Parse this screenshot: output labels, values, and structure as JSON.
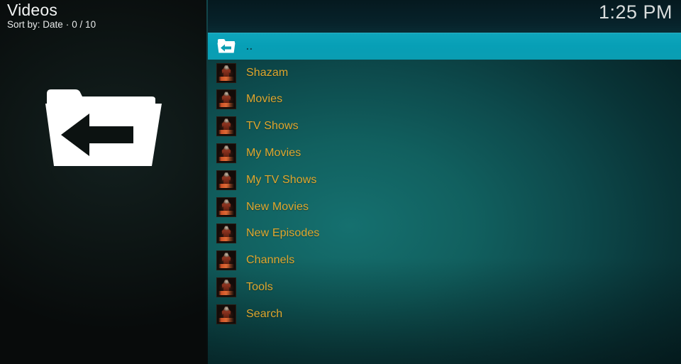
{
  "header": {
    "title": "Videos",
    "sort_label": "Sort by: Date",
    "separator": "·",
    "count": "0 / 10",
    "clock": "1:25 PM"
  },
  "left_panel": {
    "icon": "folder-back-icon"
  },
  "list": {
    "items": [
      {
        "label": "..",
        "icon": "folder-back-icon",
        "selected": true
      },
      {
        "label": "Shazam",
        "icon": "addon-thumbnail-icon",
        "selected": false
      },
      {
        "label": "Movies",
        "icon": "addon-thumbnail-icon",
        "selected": false
      },
      {
        "label": "TV Shows",
        "icon": "addon-thumbnail-icon",
        "selected": false
      },
      {
        "label": "My Movies",
        "icon": "addon-thumbnail-icon",
        "selected": false
      },
      {
        "label": "My TV Shows",
        "icon": "addon-thumbnail-icon",
        "selected": false
      },
      {
        "label": "New Movies",
        "icon": "addon-thumbnail-icon",
        "selected": false
      },
      {
        "label": "New Episodes",
        "icon": "addon-thumbnail-icon",
        "selected": false
      },
      {
        "label": "Channels",
        "icon": "addon-thumbnail-icon",
        "selected": false
      },
      {
        "label": "Tools",
        "icon": "addon-thumbnail-icon",
        "selected": false
      },
      {
        "label": "Search",
        "icon": "addon-thumbnail-icon",
        "selected": false
      }
    ]
  },
  "colors": {
    "highlight": "#0aa2b8",
    "item_text": "#e0a72e",
    "header_text": "#f2f4f4",
    "clock_text": "#d8dcdc",
    "left_panel_bg": "#0a0d0d"
  }
}
